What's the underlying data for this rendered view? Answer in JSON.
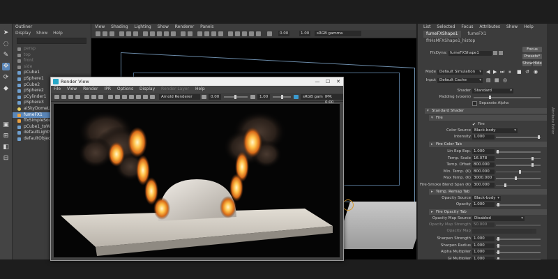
{
  "colors": {
    "accent": "#5a86b8",
    "viewport_bg": "#000000",
    "panel_bg": "#3c3c3c",
    "fire": "#e9a040"
  },
  "outliner": {
    "title": "Outliner",
    "menu": [
      "Display",
      "Show",
      "Help"
    ],
    "items": [
      {
        "label": "persp",
        "icon": "camera-icon",
        "dim": true
      },
      {
        "label": "top",
        "icon": "camera-icon",
        "dim": true
      },
      {
        "label": "front",
        "icon": "camera-icon",
        "dim": true
      },
      {
        "label": "side",
        "icon": "camera-icon",
        "dim": true
      },
      {
        "label": "pCube1",
        "icon": "mesh-icon"
      },
      {
        "label": "pSphere1",
        "icon": "mesh-icon"
      },
      {
        "label": "pCube2",
        "icon": "mesh-icon"
      },
      {
        "label": "pSphere2",
        "icon": "mesh-icon"
      },
      {
        "label": "pCylinder1",
        "icon": "mesh-icon"
      },
      {
        "label": "pSphere3",
        "icon": "mesh-icon"
      },
      {
        "label": "aiSkyDomeLight",
        "icon": "light-icon"
      },
      {
        "label": "fumeFX1",
        "icon": "fumefx-icon",
        "selected": true
      },
      {
        "label": "ffxSimpleSourc",
        "icon": "fumefx-icon"
      },
      {
        "label": "pCube1_toWor",
        "icon": "mesh-icon"
      },
      {
        "label": "defaultLightSet",
        "icon": "set-icon"
      },
      {
        "label": "defaultObjectS",
        "icon": "set-icon"
      }
    ]
  },
  "viewport": {
    "menu": [
      "View",
      "Shading",
      "Lighting",
      "Show",
      "Renderer",
      "Panels"
    ],
    "field1": "0.00",
    "field2": "1.00",
    "color_space": "sRGB gamma"
  },
  "render_view": {
    "title": "Render View",
    "controls": {
      "minimize": "—",
      "maximize": "☐",
      "close": "✕"
    },
    "menu": [
      "File",
      "View",
      "Render",
      "IPR",
      "Options",
      "Display",
      "Render Layer",
      "Help"
    ],
    "menu_disabled": [
      "Render Layer"
    ],
    "renderer": "Arnold Renderer",
    "exposure": "0.00",
    "gamma": "1.00",
    "color_space": "sRGB gam",
    "ratio": "1:1",
    "ipr": "IPR: 0:00"
  },
  "attribute_editor": {
    "menu": [
      "List",
      "Selected",
      "Focus",
      "Attributes",
      "Show",
      "Help"
    ],
    "tabs": [
      "fumeFXShape1",
      "fumeFX1",
      "fhHsMFXShape1_histop"
    ],
    "node_type_label": "FfxDyna:",
    "node_name": "fumeFXShape1",
    "buttons": {
      "focus": "Focus",
      "presets": "Presets*",
      "show": "Show",
      "hide": "Hide"
    },
    "mode_label": "Mode",
    "mode_value": "Default Simulation",
    "input_label": "Input",
    "input_value": "Default Cache",
    "shader_label": "Shader",
    "shader_value": "Standard",
    "padding_label": "Padding (voxels)",
    "separate_alpha": "Separate Alpha",
    "sections": {
      "standard_shader": "Standard Shader",
      "fire": "Fire",
      "fire_color": "Fire Color Tab",
      "temp_remap": "Temp. Remap Tab",
      "fire_opacity": "Fire Opacity Tab"
    },
    "fire_checkbox": "Fire",
    "color_source_label": "Color Source",
    "color_source_value": "Black-body",
    "intensity_label": "Intensity",
    "intensity_value": "1.000",
    "fire_color_rows": [
      {
        "label": "Lin Exp Exp.",
        "value": "1.000",
        "level": 0.02
      },
      {
        "label": "Temp. Scale",
        "value": "16.078",
        "level": 0.85
      },
      {
        "label": "Temp. Offset",
        "value": "800.000",
        "level": 0.85
      },
      {
        "label": "Min. Temp. (K)",
        "value": "800.000",
        "level": 0.55
      },
      {
        "label": "Max Temp. (K)",
        "value": "3000.000",
        "level": 0.45
      },
      {
        "label": "Fire-Smoke Blend Span (K)",
        "value": "300.000",
        "level": 0.2
      }
    ],
    "opacity_source_label": "Opacity Source",
    "opacity_source_value": "Black-body",
    "opacity_label": "Opacity",
    "opacity_value": "1.000",
    "opacity_map_source_label": "Opacity Map Source",
    "opacity_map_source_value": "Disabled",
    "opacity_map_strength_label": "Opacity Map Strength",
    "opacity_map_strength_value": "50.000",
    "opacity_map_label": "Opacity Map",
    "tail_rows": [
      {
        "label": "Sharpen Strength",
        "value": "1.000"
      },
      {
        "label": "Sharpen Radius",
        "value": "1.000"
      },
      {
        "label": "Alpha Multiplier",
        "value": "1.000"
      },
      {
        "label": "GI Multiplier",
        "value": "1.000"
      }
    ]
  },
  "side_tab": "Attribute Editor"
}
